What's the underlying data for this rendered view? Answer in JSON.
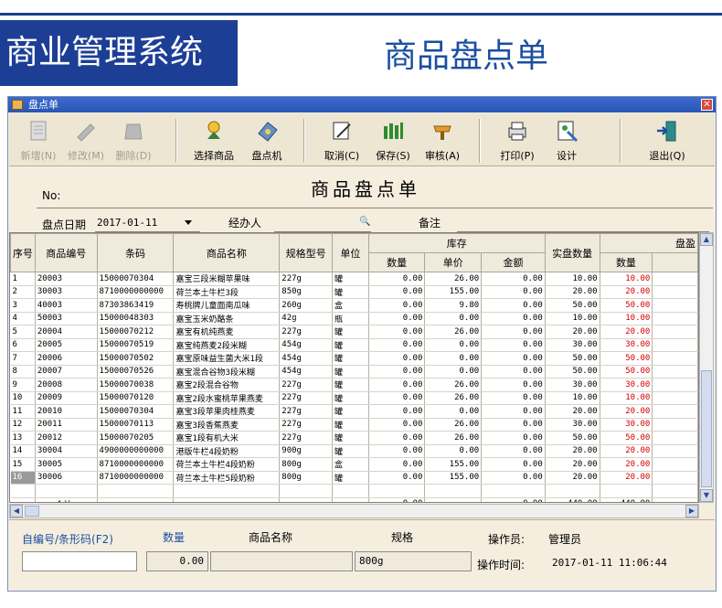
{
  "banner": {
    "system_title": "商业管理系统",
    "doc_title": "商品盘点单"
  },
  "window": {
    "title": "盘点单",
    "close_glyph": "✕"
  },
  "toolbar": [
    {
      "label": "新增(N)",
      "icon": "new-document-icon",
      "enabled": false
    },
    {
      "label": "修改(M)",
      "icon": "edit-icon",
      "enabled": false
    },
    {
      "label": "删除(D)",
      "icon": "delete-icon",
      "enabled": false
    },
    {
      "label": "选择商品",
      "icon": "select-goods-icon",
      "enabled": true
    },
    {
      "label": "盘点机",
      "icon": "scanner-icon",
      "enabled": true
    },
    {
      "label": "取消(C)",
      "icon": "cancel-icon",
      "enabled": true
    },
    {
      "label": "保存(S)",
      "icon": "save-icon",
      "enabled": true
    },
    {
      "label": "审核(A)",
      "icon": "audit-icon",
      "enabled": true
    },
    {
      "label": "打印(P)",
      "icon": "print-icon",
      "enabled": true
    },
    {
      "label": "设计",
      "icon": "design-icon",
      "enabled": true
    },
    {
      "label": "退出(Q)",
      "icon": "exit-icon",
      "enabled": true
    }
  ],
  "form": {
    "title": "商品盘点单",
    "no_label": "No:",
    "date_label": "盘点日期",
    "date_value": "2017-01-11",
    "handler_label": "经办人",
    "remark_label": "备注"
  },
  "grid": {
    "columns": [
      "序号",
      "商品编号",
      "条码",
      "商品名称",
      "规格型号",
      "单位",
      "库存",
      "实盘数量",
      "盘盈"
    ],
    "stock_sub": [
      "数量",
      "单价",
      "金额"
    ],
    "gain_sub": [
      "数量"
    ],
    "rows": [
      {
        "idx": "1",
        "code": "20003",
        "barcode": "15000070304",
        "name": "嘉宝三段米糊苹果味",
        "spec": "227g",
        "unit": "罐",
        "qty": "0.00",
        "price": "26.00",
        "amount": "0.00",
        "actual": "10.00",
        "gain": "10.00"
      },
      {
        "idx": "2",
        "code": "30003",
        "barcode": "8710000000000",
        "name": "荷兰本土牛栏3段",
        "spec": "850g",
        "unit": "罐",
        "qty": "0.00",
        "price": "155.00",
        "amount": "0.00",
        "actual": "20.00",
        "gain": "20.00"
      },
      {
        "idx": "3",
        "code": "40003",
        "barcode": "87303863419",
        "name": "寿桃牌儿童面南瓜味",
        "spec": "260g",
        "unit": "盒",
        "qty": "0.00",
        "price": "9.80",
        "amount": "0.00",
        "actual": "50.00",
        "gain": "50.00"
      },
      {
        "idx": "4",
        "code": "50003",
        "barcode": "15000048303",
        "name": "嘉宝玉米奶酪条",
        "spec": "42g",
        "unit": "瓶",
        "qty": "0.00",
        "price": "0.00",
        "amount": "0.00",
        "actual": "10.00",
        "gain": "10.00"
      },
      {
        "idx": "5",
        "code": "20004",
        "barcode": "15000070212",
        "name": "嘉宝有机纯燕麦",
        "spec": "227g",
        "unit": "罐",
        "qty": "0.00",
        "price": "26.00",
        "amount": "0.00",
        "actual": "20.00",
        "gain": "20.00"
      },
      {
        "idx": "6",
        "code": "20005",
        "barcode": "15000070519",
        "name": "嘉宝纯燕麦2段米糊",
        "spec": "454g",
        "unit": "罐",
        "qty": "0.00",
        "price": "0.00",
        "amount": "0.00",
        "actual": "30.00",
        "gain": "30.00"
      },
      {
        "idx": "7",
        "code": "20006",
        "barcode": "15000070502",
        "name": "嘉宝原味益生菌大米1段",
        "spec": "454g",
        "unit": "罐",
        "qty": "0.00",
        "price": "0.00",
        "amount": "0.00",
        "actual": "50.00",
        "gain": "50.00"
      },
      {
        "idx": "8",
        "code": "20007",
        "barcode": "15000070526",
        "name": "嘉宝混合谷物3段米糊",
        "spec": "454g",
        "unit": "罐",
        "qty": "0.00",
        "price": "0.00",
        "amount": "0.00",
        "actual": "50.00",
        "gain": "50.00"
      },
      {
        "idx": "9",
        "code": "20008",
        "barcode": "15000070038",
        "name": "嘉宝2段混合谷物",
        "spec": "227g",
        "unit": "罐",
        "qty": "0.00",
        "price": "26.00",
        "amount": "0.00",
        "actual": "30.00",
        "gain": "30.00"
      },
      {
        "idx": "10",
        "code": "20009",
        "barcode": "15000070120",
        "name": "嘉宝2段水蜜桃苹果燕麦",
        "spec": "227g",
        "unit": "罐",
        "qty": "0.00",
        "price": "26.00",
        "amount": "0.00",
        "actual": "10.00",
        "gain": "10.00"
      },
      {
        "idx": "11",
        "code": "20010",
        "barcode": "15000070304",
        "name": "嘉宝3段苹果肉桂燕麦",
        "spec": "227g",
        "unit": "罐",
        "qty": "0.00",
        "price": "0.00",
        "amount": "0.00",
        "actual": "20.00",
        "gain": "20.00"
      },
      {
        "idx": "12",
        "code": "20011",
        "barcode": "15000070113",
        "name": "嘉宝3段香蕉燕麦",
        "spec": "227g",
        "unit": "罐",
        "qty": "0.00",
        "price": "26.00",
        "amount": "0.00",
        "actual": "30.00",
        "gain": "30.00"
      },
      {
        "idx": "13",
        "code": "20012",
        "barcode": "15000070205",
        "name": "嘉宝1段有机大米",
        "spec": "227g",
        "unit": "罐",
        "qty": "0.00",
        "price": "26.00",
        "amount": "0.00",
        "actual": "50.00",
        "gain": "50.00"
      },
      {
        "idx": "14",
        "code": "30004",
        "barcode": "4900000000000",
        "name": "港版牛栏4段奶粉",
        "spec": "900g",
        "unit": "罐",
        "qty": "0.00",
        "price": "0.00",
        "amount": "0.00",
        "actual": "20.00",
        "gain": "20.00"
      },
      {
        "idx": "15",
        "code": "30005",
        "barcode": "8710000000000",
        "name": "荷兰本土牛栏4段奶粉",
        "spec": "800g",
        "unit": "盒",
        "qty": "0.00",
        "price": "155.00",
        "amount": "0.00",
        "actual": "20.00",
        "gain": "20.00"
      },
      {
        "idx": "16",
        "code": "30006",
        "barcode": "8710000000000",
        "name": "荷兰本土牛栏5段奶粉",
        "spec": "800g",
        "unit": "罐",
        "qty": "0.00",
        "price": "155.00",
        "amount": "0.00",
        "actual": "20.00",
        "gain": "20.00"
      }
    ],
    "selected_index": 15,
    "total": {
      "label": "合计:",
      "qty": "0.00",
      "amount": "0.00",
      "actual": "440.00",
      "gain": "440.00"
    }
  },
  "bottom": {
    "barcode_label": "自编号/条形码(F2)",
    "qty_label": "数量",
    "name_label": "商品名称",
    "spec_label": "规格",
    "qty_value": "0.00",
    "spec_value": "800g",
    "operator_label": "操作员:",
    "operator_value": "管理员",
    "optime_label": "操作时间:",
    "optime_value": "2017-01-11  11:06:44"
  },
  "colors": {
    "banner_bg": "#1c3f95",
    "title_blue": "#1b4fa0",
    "gain_red": "#d40000",
    "window_bg": "#f5eedf"
  }
}
